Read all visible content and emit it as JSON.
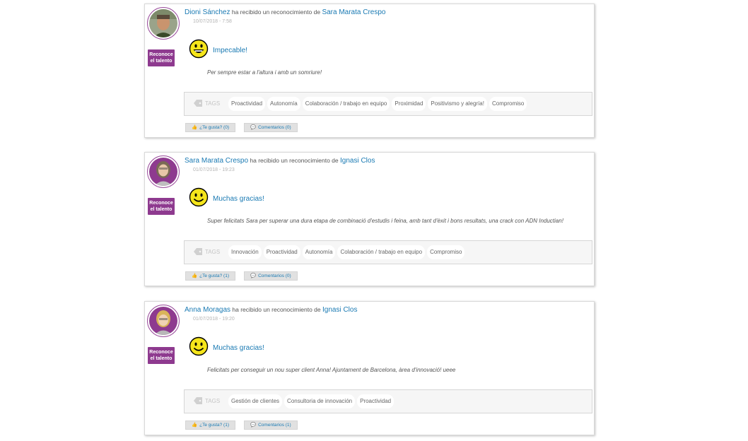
{
  "cards": [
    {
      "recipient": "Dioni Sánchez",
      "mid_text": " ha recibido un reconocimiento de ",
      "giver": "Sara Marata Crespo",
      "date": "10/07/2018 - 7:58",
      "reconoce_label": "Reconoce el talento",
      "award": "Impecable!",
      "smiley": "grin-smiley-icon",
      "message": "Per sempre estar a l'altura i amb un somriure!",
      "tags_label": "TAGS",
      "tags": [
        "Proactividad",
        "Autonomía",
        "Colaboración / trabajo en equipo",
        "Proximidad",
        "Positivismo y alegría!",
        "Compromiso"
      ],
      "likes_label": "¿Te gusta? (0)",
      "comments_label": "Comentarios (0)"
    },
    {
      "recipient": "Sara Marata Crespo",
      "mid_text": " ha recibido un reconocimiento de ",
      "giver": "Ignasi Clos",
      "date": "01/07/2018 - 19:23",
      "reconoce_label": "Reconoce el talento",
      "award": "Muchas gracias!",
      "smiley": "smile-icon",
      "message": "Super felicitats Sara per superar una dura etapa de combinació d'estudis i feina, amb tant d'èxit i bons resultats, una crack con ADN Inductian!",
      "tags_label": "TAGS",
      "tags": [
        "Innovación",
        "Proactividad",
        "Autonomía",
        "Colaboración / trabajo en equipo",
        "Compromiso"
      ],
      "likes_label": "¿Te gusta? (1)",
      "comments_label": "Comentarios (0)"
    },
    {
      "recipient": "Anna Moragas",
      "mid_text": " ha recibido un reconocimiento de ",
      "giver": "Ignasi Clos",
      "date": "01/07/2018 - 19:20",
      "reconoce_label": "Reconoce el talento",
      "award": "Muchas gracias!",
      "smiley": "smile-icon",
      "message": "Felicitats per conseguir un nou super client Anna! Ajuntament de Barcelona, àrea d'innovació! ueee",
      "tags_label": "TAGS",
      "tags": [
        "Gestión de clientes",
        "Consultoria de innovación",
        "Proactividad"
      ],
      "likes_label": "¿Te gusta? (1)",
      "comments_label": "Comentarios (1)"
    }
  ],
  "colors": {
    "link": "#1a7ab3",
    "accent_purple": "#8e3a8f",
    "smiley_yellow": "#f5e51b"
  }
}
